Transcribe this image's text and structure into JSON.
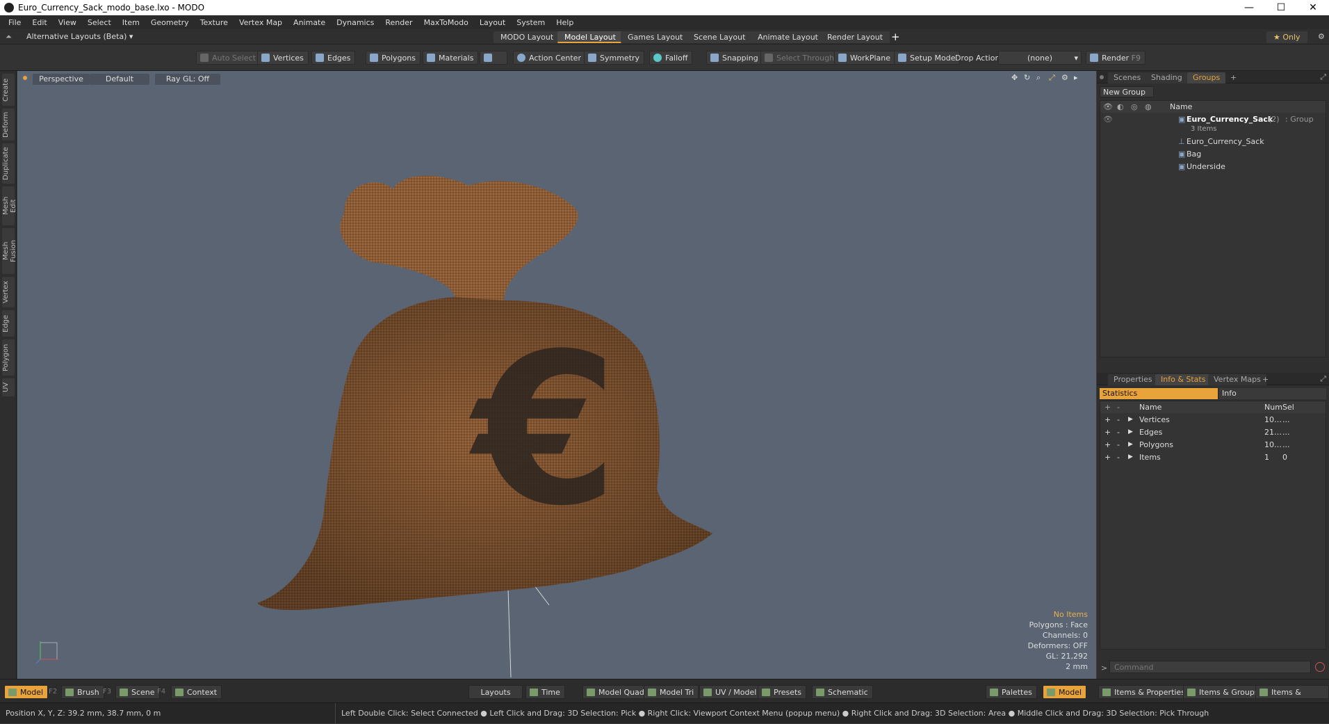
{
  "window": {
    "title": "Euro_Currency_Sack_modo_base.lxo - MODO",
    "controls": [
      "—",
      "☐",
      "✕"
    ]
  },
  "menu": [
    "File",
    "Edit",
    "View",
    "Select",
    "Item",
    "Geometry",
    "Texture",
    "Vertex Map",
    "Animate",
    "Dynamics",
    "Render",
    "MaxToModo",
    "Layout",
    "System",
    "Help"
  ],
  "layouts": {
    "selector": "Alternative Layouts (Beta) ▾",
    "tabs": [
      "MODO Layout",
      "Model Layout",
      "Games Layout",
      "Scene Layout",
      "Animate Layout",
      "Render Layout"
    ],
    "add": "+",
    "only": "★ Only"
  },
  "toolbar": {
    "auto_select": "Auto Select",
    "vertices": "Vertices",
    "edges": "Edges",
    "polygons": "Polygons",
    "materials": "Materials",
    "action_center": "Action Center",
    "symmetry": "Symmetry",
    "falloff": "Falloff",
    "snapping": "Snapping",
    "select_through": "Select Through",
    "workplane": "WorkPlane",
    "setup_mode": "Setup Mode",
    "drop_action": "Drop Action",
    "drop_value": "(none)",
    "render": "Render",
    "render_key": "F9"
  },
  "left_tabs": [
    "Create",
    "Deform",
    "Duplicate",
    "Mesh Edit",
    "Mesh Fusion",
    "Vertex",
    "Edge",
    "Polygon",
    "UV"
  ],
  "viewport": {
    "view": "Perspective",
    "shading": "Default",
    "raygl": "Ray GL: Off",
    "stats": {
      "items": "No Items",
      "polygons": "Polygons : Face",
      "channels": "Channels: 0",
      "deformers": "Deformers: OFF",
      "gl": "GL: 21,292",
      "scale": "2 mm"
    }
  },
  "groups_panel": {
    "tabs": [
      "Scenes",
      "Shading",
      "Groups",
      "+"
    ],
    "new_group": "New Group",
    "col_name": "Name",
    "group_name": "Euro_Currency_Sack",
    "group_count": "(2)",
    "group_type": ": Group",
    "group_items": "3 Items",
    "children": [
      "Euro_Currency_Sack",
      "Bag",
      "Underside"
    ]
  },
  "info_panel": {
    "tabs": [
      "Properties",
      "Info & Stats",
      "Vertex Maps",
      "+"
    ],
    "statistics": "Statistics",
    "info": "Info",
    "cols": [
      "Name",
      "Num",
      "Sel"
    ],
    "rows": [
      {
        "name": "Vertices",
        "num": "10…",
        "sel": "..."
      },
      {
        "name": "Edges",
        "num": "21…",
        "sel": "..."
      },
      {
        "name": "Polygons",
        "num": "10…",
        "sel": "..."
      },
      {
        "name": "Items",
        "num": "1",
        "sel": "0"
      }
    ],
    "command": "Command"
  },
  "bottom": {
    "model": "Model",
    "model_key": "F2",
    "brush": "Brush",
    "brush_key": "F3",
    "scene": "Scene",
    "scene_key": "F4",
    "context": "Context",
    "layouts": "Layouts",
    "time": "Time",
    "model_quad": "Model Quad",
    "model_tri": "Model Tri",
    "uv_model": "UV / Model",
    "presets": "Presets",
    "schematic": "Schematic",
    "palettes": "Palettes",
    "model2": "Model",
    "items_props": "Items & Properties",
    "items_groups": "Items & Groups",
    "items_shading": "Items & Shading"
  },
  "status": {
    "position": "Position X, Y, Z:  39.2 mm, 38.7 mm, 0 m",
    "hint": "Left Double Click: Select Connected ● Left Click and Drag: 3D Selection: Pick ● Right Click: Viewport Context Menu (popup menu) ● Right Click and Drag: 3D Selection: Area ● Middle Click and Drag: 3D Selection: Pick Through"
  }
}
